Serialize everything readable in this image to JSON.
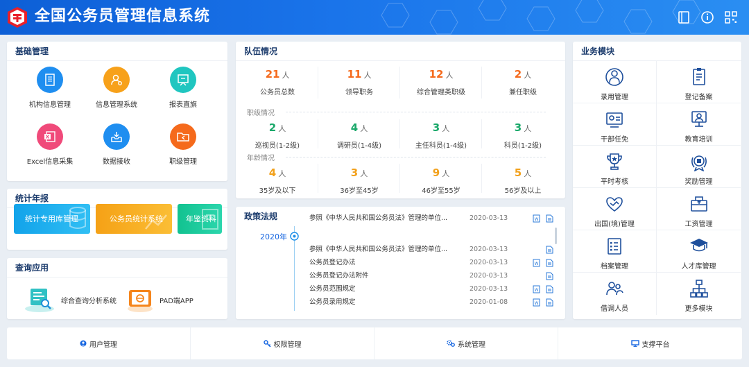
{
  "header": {
    "title": "全国公务员管理信息系统",
    "icons": [
      "book-icon",
      "info-icon",
      "qrcode-icon"
    ]
  },
  "basic": {
    "title": "基础管理",
    "items": [
      {
        "label": "机构信息管理",
        "icon": "org-doc-icon",
        "color": "#1f8ef0"
      },
      {
        "label": "信息管理系统",
        "icon": "user-gear-icon",
        "color": "#f7a11a"
      },
      {
        "label": "报表直旗",
        "icon": "report-board-icon",
        "color": "#20c6c0"
      },
      {
        "label": "Excel信息采集",
        "icon": "excel-icon",
        "color": "#f04a7a"
      },
      {
        "label": "数据接收",
        "icon": "inbox-icon",
        "color": "#1f8ef0"
      },
      {
        "label": "职级管理",
        "icon": "folder-icon",
        "color": "#f56a1c"
      }
    ]
  },
  "stats": {
    "title": "统计年报",
    "buttons": [
      {
        "label": "统计专用库管理",
        "color": "#1ba8ea"
      },
      {
        "label": "公务员统计系统",
        "color": "#f7a91c"
      },
      {
        "label": "年鉴资料",
        "color": "#16c69a"
      }
    ]
  },
  "query": {
    "title": "查询应用",
    "items": [
      {
        "label": "综合查询分析系统",
        "icon": "search-chart-icon"
      },
      {
        "label": "PAD端APP",
        "icon": "tablet-icon"
      }
    ]
  },
  "team": {
    "title": "队伍情况",
    "unit": "人",
    "row1": [
      {
        "num": "21",
        "label": "公务员总数",
        "color": "#f56a1c"
      },
      {
        "num": "11",
        "label": "领导职务",
        "color": "#f56a1c"
      },
      {
        "num": "12",
        "label": "综合管理类职级",
        "color": "#f56a1c"
      },
      {
        "num": "2",
        "label": "兼任职级",
        "color": "#f56a1c"
      }
    ],
    "rank_title": "职级情况",
    "row2": [
      {
        "num": "2",
        "label": "巡视员(1-2级)",
        "color": "#1aa86a"
      },
      {
        "num": "4",
        "label": "调研员(1-4级)",
        "color": "#1aa86a"
      },
      {
        "num": "3",
        "label": "主任科员(1-4级)",
        "color": "#1aa86a"
      },
      {
        "num": "3",
        "label": "科员(1-2级)",
        "color": "#1aa86a"
      }
    ],
    "age_title": "年龄情况",
    "row3": [
      {
        "num": "4",
        "label": "35岁及以下",
        "color": "#f2a11c"
      },
      {
        "num": "3",
        "label": "36岁至45岁",
        "color": "#f2a11c"
      },
      {
        "num": "9",
        "label": "46岁至55岁",
        "color": "#f2a11c"
      },
      {
        "num": "5",
        "label": "56岁及以上",
        "color": "#f2a11c"
      }
    ]
  },
  "policy": {
    "title": "政策法规",
    "year": "2020年",
    "rows": [
      {
        "title": "参照《中华人民共和国公务员法》管理的单位...",
        "date": "2020-03-13",
        "icons": 2
      },
      {
        "title": "参照《中华人民共和国公务员法》管理的单位...",
        "date": "2020-03-13",
        "icons": 1
      },
      {
        "title": "公务员登记办法",
        "date": "2020-03-13",
        "icons": 2
      },
      {
        "title": "公务员登记办法附件",
        "date": "2020-03-13",
        "icons": 1
      },
      {
        "title": "公务员范围规定",
        "date": "2020-03-13",
        "icons": 2
      },
      {
        "title": "公务员录用规定",
        "date": "2020-01-08",
        "icons": 2
      }
    ]
  },
  "business": {
    "title": "业务模块",
    "items": [
      {
        "label": "录用管理",
        "icon": "people-hire-icon"
      },
      {
        "label": "登记备案",
        "icon": "register-icon"
      },
      {
        "label": "干部任免",
        "icon": "appoint-icon"
      },
      {
        "label": "教育培训",
        "icon": "training-icon"
      },
      {
        "label": "平时考核",
        "icon": "trophy-icon"
      },
      {
        "label": "奖励管理",
        "icon": "medal-icon"
      },
      {
        "label": "出国(境)管理",
        "icon": "handshake-icon"
      },
      {
        "label": "工资管理",
        "icon": "salary-icon"
      },
      {
        "label": "档案管理",
        "icon": "archive-icon"
      },
      {
        "label": "人才库管理",
        "icon": "graduate-icon"
      },
      {
        "label": "借调人员",
        "icon": "transfer-icon"
      },
      {
        "label": "更多模块",
        "icon": "org-tree-icon"
      }
    ]
  },
  "bottom": {
    "items": [
      {
        "label": "用户管理",
        "icon": "user-icon"
      },
      {
        "label": "权限管理",
        "icon": "key-icon"
      },
      {
        "label": "系统管理",
        "icon": "gears-icon"
      },
      {
        "label": "支撑平台",
        "icon": "monitor-icon"
      }
    ]
  },
  "colors": {
    "primary": "#1565e0",
    "icon_blue": "#1e4f9c"
  }
}
